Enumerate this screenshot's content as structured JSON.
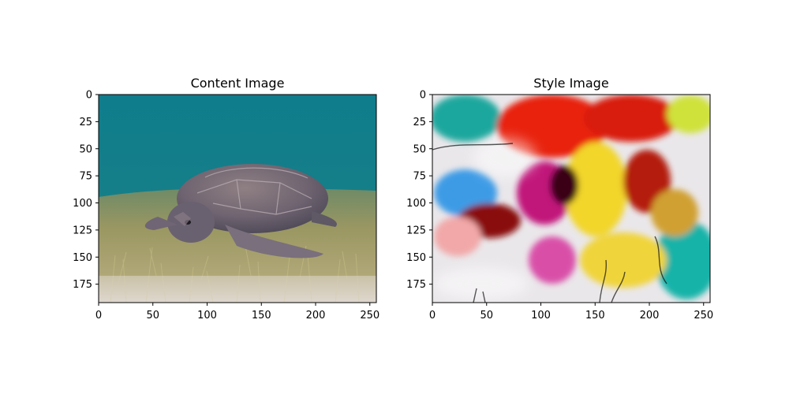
{
  "chart_data": [
    {
      "type": "image",
      "title": "Content Image",
      "subject": "sea turtle resting on seagrass underwater",
      "image_size": [
        256,
        192
      ],
      "xlim": [
        0,
        256
      ],
      "ylim": [
        192,
        0
      ],
      "xticks": [
        0,
        50,
        100,
        150,
        200,
        250
      ],
      "yticks": [
        0,
        25,
        50,
        75,
        100,
        125,
        150,
        175
      ],
      "colors": {
        "water": "#0d7e8c",
        "sand": "#a39a66",
        "turtle": "#6d6170"
      }
    },
    {
      "type": "image",
      "title": "Style Image",
      "subject": "abstract fluid paint texture",
      "image_size": [
        256,
        192
      ],
      "xlim": [
        0,
        256
      ],
      "ylim": [
        192,
        0
      ],
      "xticks": [
        0,
        50,
        100,
        150,
        200,
        250
      ],
      "yticks": [
        0,
        25,
        50,
        75,
        100,
        125,
        150,
        175
      ],
      "colors": {
        "red": "#e8200c",
        "yellow": "#f2d62a",
        "teal": "#14b0a8",
        "magenta": "#c1127a",
        "blue": "#3d9be6",
        "dark-red": "#8a0a0a"
      }
    }
  ]
}
